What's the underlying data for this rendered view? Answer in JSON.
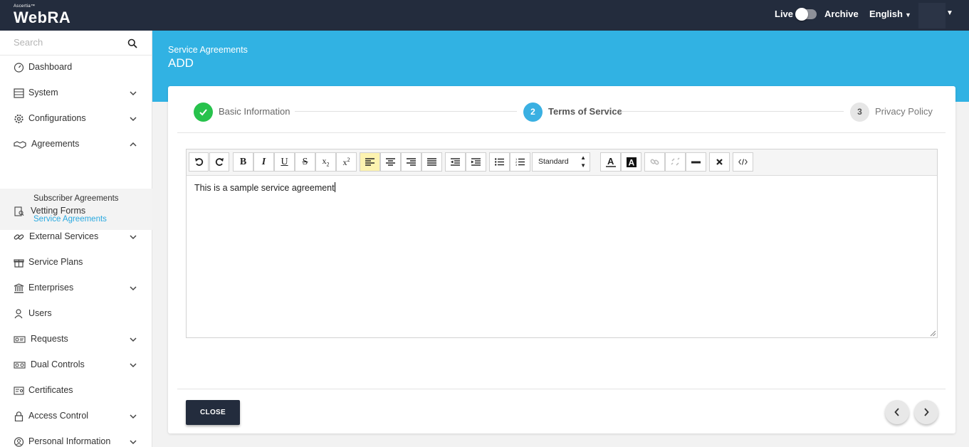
{
  "topbar": {
    "logo_small": "Ascertia™",
    "logo_main": "WebRA",
    "live_label": "Live",
    "archive_label": "Archive",
    "language": "English"
  },
  "sidebar": {
    "search_placeholder": "Search",
    "items": [
      {
        "label": "Dashboard",
        "icon": "dashboard-icon"
      },
      {
        "label": "System",
        "icon": "system-icon",
        "expandable": true
      },
      {
        "label": "Configurations",
        "icon": "gear-icon",
        "expandable": true
      },
      {
        "label": "Agreements",
        "icon": "handshake-icon",
        "expandable": true,
        "expanded": true
      },
      {
        "label": "Vetting Forms",
        "icon": "vetting-icon"
      },
      {
        "label": "External Services",
        "icon": "link-icon",
        "expandable": true
      },
      {
        "label": "Service Plans",
        "icon": "gift-icon"
      },
      {
        "label": "Enterprises",
        "icon": "bank-icon",
        "expandable": true
      },
      {
        "label": "Users",
        "icon": "users-icon"
      },
      {
        "label": "Requests",
        "icon": "requests-icon",
        "expandable": true
      },
      {
        "label": "Dual Controls",
        "icon": "dual-controls-icon",
        "expandable": true
      },
      {
        "label": "Certificates",
        "icon": "certificate-icon"
      },
      {
        "label": "Access Control",
        "icon": "lock-icon",
        "expandable": true
      },
      {
        "label": "Personal Information",
        "icon": "user-circle-icon",
        "expandable": true
      }
    ],
    "agreements_sub": [
      "Subscriber Agreements",
      "Service Agreements"
    ],
    "active_sub": "Service Agreements"
  },
  "header": {
    "breadcrumb": "Service Agreements",
    "title": "ADD"
  },
  "stepper": {
    "steps": [
      {
        "number": "1",
        "label": "Basic Information",
        "state": "done"
      },
      {
        "number": "2",
        "label": "Terms of Service",
        "state": "active"
      },
      {
        "number": "3",
        "label": "Privacy Policy",
        "state": "pending"
      }
    ]
  },
  "editor": {
    "font_select": "Standard",
    "content": "This is a sample service agreement",
    "toolbar_buttons": [
      "undo",
      "redo",
      "bold",
      "italic",
      "underline",
      "strikethrough",
      "subscript",
      "superscript",
      "align-left",
      "align-center",
      "align-right",
      "justify",
      "outdent",
      "indent",
      "bullet-list",
      "numbered-list",
      "font-size",
      "text-color",
      "background-color",
      "link",
      "unlink",
      "horizontal-rule",
      "remove-format",
      "source-code"
    ]
  },
  "footer": {
    "close_label": "CLOSE"
  },
  "colors": {
    "topbar": "#232c3d",
    "accent": "#31b2e3",
    "step_done": "#27c24c",
    "step_active": "#3ab0e2"
  }
}
